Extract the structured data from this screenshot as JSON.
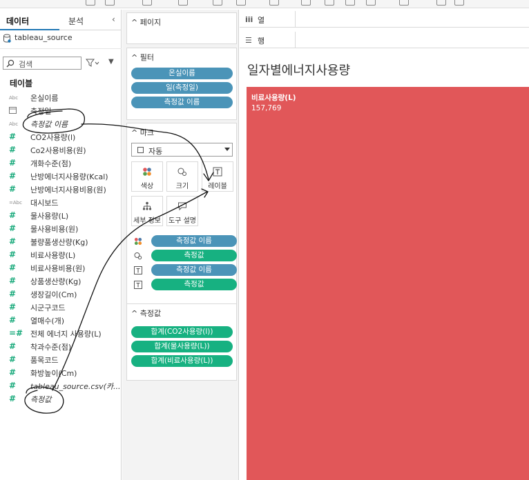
{
  "data_pane": {
    "tabs": {
      "data": "데이터",
      "analysis": "분석"
    },
    "source_name": "tableau_source",
    "search_placeholder": "검색",
    "section_title": "테이블",
    "fields": [
      {
        "label": "온실이름",
        "type": "abc",
        "italic": false
      },
      {
        "label": "측정일",
        "type": "calendar",
        "italic": false
      },
      {
        "label": "측정값 이름",
        "type": "abc",
        "italic": true
      },
      {
        "label": "CO2사용량(l)",
        "type": "measure",
        "italic": false
      },
      {
        "label": "Co2사용비용(원)",
        "type": "measure",
        "italic": false
      },
      {
        "label": "개화수준(점)",
        "type": "measure",
        "italic": false
      },
      {
        "label": "난방에너지사용량(Kcal)",
        "type": "measure",
        "italic": false
      },
      {
        "label": "난방에너지사용비용(원)",
        "type": "measure",
        "italic": false
      },
      {
        "label": "대시보드",
        "type": "abc-calc",
        "italic": false
      },
      {
        "label": "물사용량(L)",
        "type": "measure",
        "italic": false
      },
      {
        "label": "물사용비용(원)",
        "type": "measure",
        "italic": false
      },
      {
        "label": "불량품생산량(Kg)",
        "type": "measure",
        "italic": false
      },
      {
        "label": "비료사용량(L)",
        "type": "measure",
        "italic": false
      },
      {
        "label": "비료사용비용(원)",
        "type": "measure",
        "italic": false
      },
      {
        "label": "상품생산량(Kg)",
        "type": "measure",
        "italic": false
      },
      {
        "label": "생장길이(Cm)",
        "type": "measure",
        "italic": false
      },
      {
        "label": "시군구코드",
        "type": "measure",
        "italic": false
      },
      {
        "label": "열매수(개)",
        "type": "measure",
        "italic": false
      },
      {
        "label": "전체 에너지 사용량(L)",
        "type": "measure-calc",
        "italic": false
      },
      {
        "label": "착과수준(점)",
        "type": "measure",
        "italic": false
      },
      {
        "label": "품목코드",
        "type": "measure",
        "italic": false
      },
      {
        "label": "화방높이(Cm)",
        "type": "measure",
        "italic": false
      },
      {
        "label": "tableau_source.csv(카...",
        "type": "measure",
        "italic": true
      },
      {
        "label": "측정값",
        "type": "measure",
        "italic": true
      }
    ]
  },
  "shelves": {
    "pages_title": "페이지",
    "filters_title": "필터",
    "filters": [
      "온실이름",
      "일(측정일)",
      "측정값 이름"
    ],
    "marks_title": "마크",
    "mark_type": "자동",
    "mark_buttons": {
      "color": "색상",
      "size": "크기",
      "label": "레이블",
      "detail": "세부 정보",
      "tooltip": "도구 설명"
    },
    "encodings": [
      {
        "icon": "color",
        "label": "측정값 이름",
        "color": "blue"
      },
      {
        "icon": "size",
        "label": "측정값",
        "color": "green"
      },
      {
        "icon": "label",
        "label": "측정값 이름",
        "color": "blue"
      },
      {
        "icon": "label",
        "label": "측정값",
        "color": "green"
      }
    ],
    "measure_values_title": "측정값",
    "measure_values": [
      "합계(CO2사용량(l))",
      "합계(물사용량(L))",
      "합계(비료사용량(L))"
    ]
  },
  "view": {
    "columns_label": "열",
    "rows_label": "행",
    "title": "일자별에너지사용량"
  },
  "chart_data": {
    "type": "treemap",
    "title": "일자별에너지사용량",
    "cells": [
      {
        "label": "비료사용량(L)",
        "value_text": "157,769",
        "value": 157769,
        "color": "#e15759"
      }
    ]
  },
  "colors": {
    "pill_blue": "#4b94b8",
    "pill_green": "#17b181",
    "treemap_red": "#e15759",
    "tab_underline": "#1f77b4"
  }
}
